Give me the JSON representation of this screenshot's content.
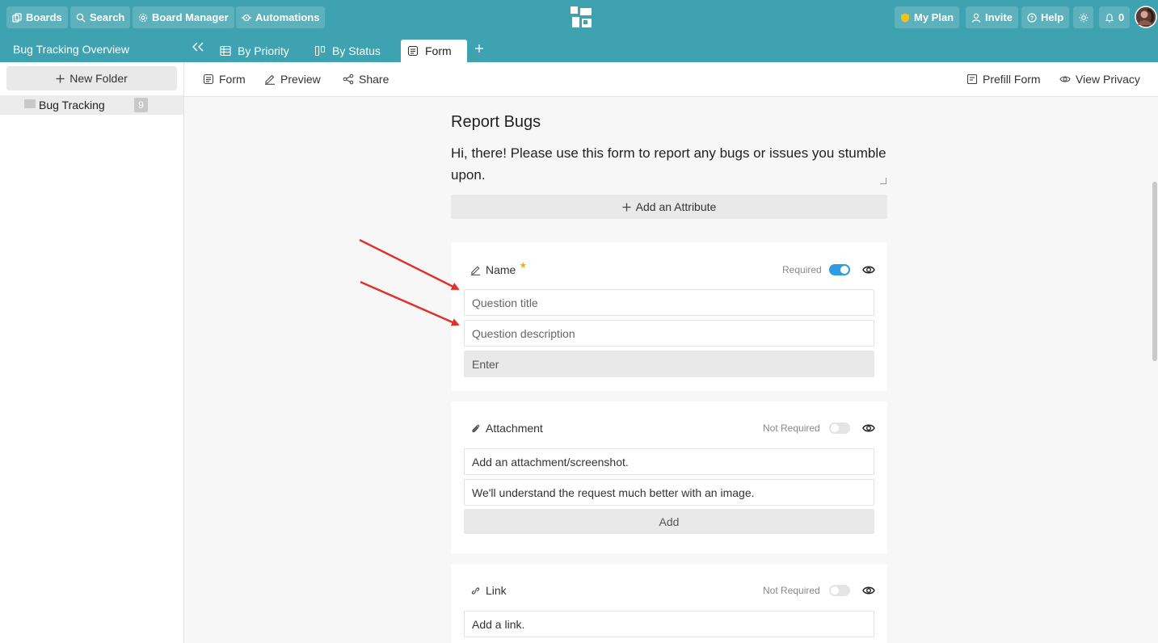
{
  "topbar": {
    "boards": "Boards",
    "search": "Search",
    "board_manager": "Board Manager",
    "automations": "Automations",
    "my_plan": "My Plan",
    "invite": "Invite",
    "help": "Help",
    "notifications": "0"
  },
  "tabbar": {
    "overview_title": "Bug Tracking Overview",
    "tabs": [
      {
        "label": "By Priority"
      },
      {
        "label": "By Status"
      },
      {
        "label": "Form"
      }
    ]
  },
  "sidebar": {
    "new_folder": "New Folder",
    "folders": [
      {
        "label": "Bug Tracking",
        "count": "9"
      }
    ]
  },
  "toolbar": {
    "form": "Form",
    "preview": "Preview",
    "share": "Share",
    "prefill": "Prefill Form",
    "view_privacy": "View Privacy"
  },
  "form": {
    "title": "Report Bugs",
    "description": "Hi, there! Please use this form to report any bugs or issues you stumble upon.",
    "add_attribute": "Add an Attribute",
    "fields": [
      {
        "name": "Name",
        "requirement": "Required",
        "required": true,
        "title_placeholder": "Question title",
        "description_placeholder": "Question description",
        "input_placeholder": "Enter"
      },
      {
        "name": "Attachment",
        "requirement": "Not Required",
        "required": false,
        "title_value": "Add an attachment/screenshot.",
        "description_value": "We'll understand the request much better with an image.",
        "button_label": "Add"
      },
      {
        "name": "Link",
        "requirement": "Not Required",
        "required": false,
        "title_value": "Add a link."
      }
    ]
  },
  "colors": {
    "brand": "#3fa2b0",
    "toggle_on": "#2f9be0",
    "required_star": "#f3b400",
    "annotation_arrow": "#e0322b"
  }
}
